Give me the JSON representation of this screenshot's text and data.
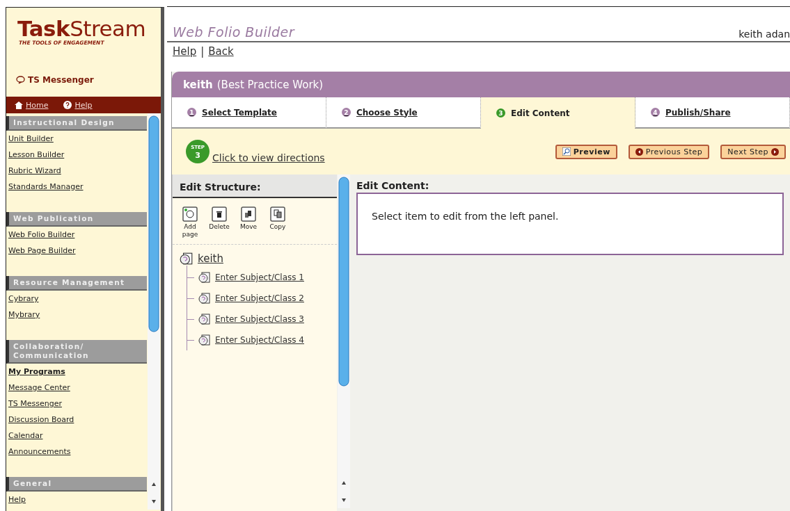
{
  "logo": {
    "brand_bold": "Task",
    "brand_light": "Stream",
    "tagline": "THE TOOLS OF ENGAGEMENT"
  },
  "messenger": {
    "label": "TS Messenger"
  },
  "nav_bar": [
    {
      "label": "Home",
      "kind": "home"
    },
    {
      "label": "Help",
      "kind": "help"
    }
  ],
  "sidebar": {
    "sections": [
      {
        "title": "Instructional Design",
        "items": [
          {
            "label": "Unit Builder",
            "selected": false
          },
          {
            "label": "Lesson Builder",
            "selected": false
          },
          {
            "label": "Rubric Wizard",
            "selected": false
          },
          {
            "label": "Standards Manager",
            "selected": false
          }
        ]
      },
      {
        "title": "Web Publication",
        "items": [
          {
            "label": "Web Folio Builder",
            "selected": false
          },
          {
            "label": "Web Page Builder",
            "selected": false
          }
        ]
      },
      {
        "title": "Resource Management",
        "items": [
          {
            "label": "Cybrary",
            "selected": false
          },
          {
            "label": "Mybrary",
            "selected": false
          }
        ]
      },
      {
        "title": "Collaboration/ Communication",
        "items": [
          {
            "label": "My Programs",
            "selected": true
          },
          {
            "label": "Message Center",
            "selected": false
          },
          {
            "label": "TS Messenger",
            "selected": false
          },
          {
            "label": "Discussion Board",
            "selected": false
          },
          {
            "label": "Calendar",
            "selected": false
          },
          {
            "label": "Announcements",
            "selected": false
          }
        ]
      },
      {
        "title": "General",
        "items": [
          {
            "label": "Help",
            "selected": false
          }
        ]
      }
    ]
  },
  "header": {
    "title": "Web Folio Builder",
    "user": "keith adan",
    "links": [
      "Help",
      "Back"
    ],
    "link_separator": "|"
  },
  "project": {
    "name": "keith",
    "subtitle": "(Best Practice Work)"
  },
  "steps": [
    {
      "number": "1",
      "label": "Select Template",
      "selected": false
    },
    {
      "number": "2",
      "label": "Choose Style",
      "selected": false
    },
    {
      "number": "3",
      "label": "Edit Content",
      "selected": true
    },
    {
      "number": "4",
      "label": "Publish/Share",
      "selected": false
    }
  ],
  "step_bar": {
    "badge_top": "STEP",
    "badge_number": "3",
    "link": "Click to view directions",
    "buttons": [
      {
        "label": "Preview",
        "kind": "preview"
      },
      {
        "label": "Previous Step",
        "kind": "previous"
      },
      {
        "label": "Next Step",
        "kind": "next"
      }
    ]
  },
  "structure": {
    "title": "Edit Structure:",
    "tools": [
      {
        "label": "Add page",
        "kind": "add"
      },
      {
        "label": "Delete",
        "kind": "delete"
      },
      {
        "label": "Move",
        "kind": "move"
      },
      {
        "label": "Copy",
        "kind": "copy"
      }
    ],
    "tree": {
      "label": "keith",
      "children": [
        {
          "label": "Enter Subject/Class 1"
        },
        {
          "label": "Enter Subject/Class 2"
        },
        {
          "label": "Enter Subject/Class 3"
        },
        {
          "label": "Enter Subject/Class 4"
        }
      ]
    }
  },
  "content": {
    "title": "Edit Content:",
    "message": "Select item to edit from the left panel."
  }
}
